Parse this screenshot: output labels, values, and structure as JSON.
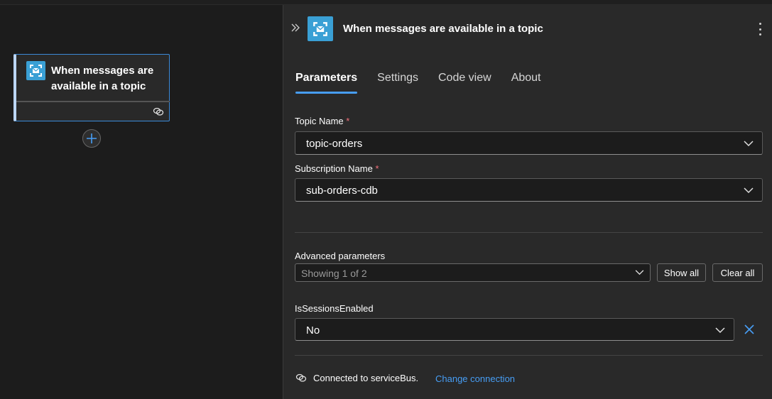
{
  "canvas": {
    "node": {
      "title": "When messages are available in a topic"
    },
    "add_button_label": "+"
  },
  "panel": {
    "title": "When messages are available in a topic",
    "tabs": [
      {
        "label": "Parameters",
        "active": true
      },
      {
        "label": "Settings",
        "active": false
      },
      {
        "label": "Code view",
        "active": false
      },
      {
        "label": "About",
        "active": false
      }
    ],
    "fields": {
      "topic_name": {
        "label": "Topic Name",
        "required_mark": "*",
        "value": "topic-orders"
      },
      "subscription_name": {
        "label": "Subscription Name",
        "required_mark": "*",
        "value": "sub-orders-cdb"
      }
    },
    "advanced": {
      "label": "Advanced parameters",
      "showing": "Showing 1 of 2",
      "show_all_label": "Show all",
      "clear_all_label": "Clear all"
    },
    "sessions": {
      "label": "IsSessionsEnabled",
      "value": "No"
    },
    "connection": {
      "text": "Connected to serviceBus.",
      "change_label": "Change connection"
    }
  },
  "colors": {
    "accent": "#479ef5",
    "icon_bg": "#3aa0d5",
    "required": "#f1707b",
    "panel_bg": "#292929",
    "canvas_bg": "#1c1c1c"
  },
  "icons": [
    "service-bus-icon",
    "link-icon",
    "plus-icon",
    "collapse-icon",
    "more-icon",
    "chevron-down-icon",
    "close-icon"
  ]
}
